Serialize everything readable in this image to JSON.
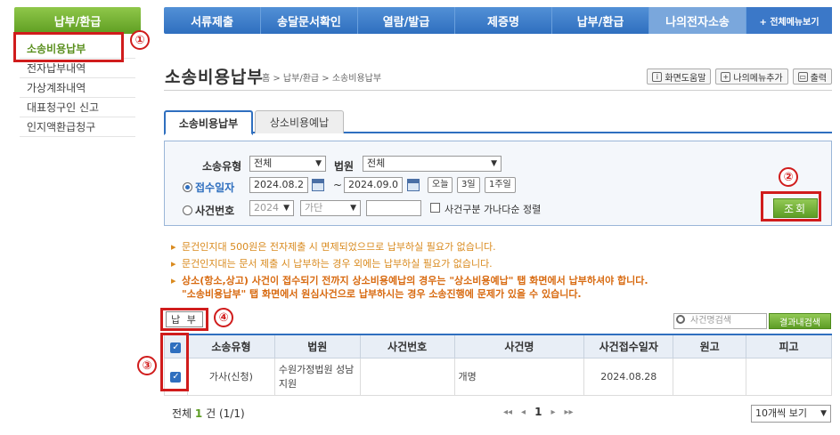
{
  "sidebar": {
    "header": "납부/환급",
    "items": [
      {
        "label": "소송비용납부"
      },
      {
        "label": "전자납부내역"
      },
      {
        "label": "가상계좌내역"
      },
      {
        "label": "대표청구인 신고"
      },
      {
        "label": "인지액환급청구"
      }
    ]
  },
  "annotations": [
    "①",
    "②",
    "③",
    "④"
  ],
  "topnav": {
    "items": [
      "서류제출",
      "송달문서확인",
      "열람/발급",
      "제증명",
      "납부/환급",
      "나의전자소송"
    ],
    "all_menu": "+ 전체메뉴보기"
  },
  "page": {
    "title": "소송비용납부",
    "breadcrumb": "홈 > 납부/환급 > 소송비용납부",
    "tools": {
      "help": "화면도움말",
      "my_menu": "나의메뉴추가",
      "print": "출력"
    }
  },
  "tabs": [
    "소송비용납부",
    "상소비용예납"
  ],
  "search": {
    "case_type_label": "소송유형",
    "case_type_value": "전체",
    "court_label": "법원",
    "court_value": "전체",
    "receipt_date_label": "접수일자",
    "date_from": "2024.08.2",
    "tilde": "~",
    "date_to": "2024.09.0",
    "quick": [
      "오늘",
      "3일",
      "1주일"
    ],
    "case_no_label": "사건번호",
    "year_value": "2024",
    "type_value": "가단",
    "sort_label": "사건구분 가나다순 정렬",
    "query_button": "조회"
  },
  "notices": [
    "문건인지대 500원은 전자제출 시 면제되었으므로 납부하실 필요가 없습니다.",
    "문건인지대는 문서 제출 시 납부하는 경우 외에는 납부하실 필요가 없습니다.",
    "상소(항소,상고) 사건이 접수되기 전까지 상소비용예납의 경우는 \"상소비용예납\" 탭 화면에서 납부하셔야 합니다.",
    "\"소송비용납부\" 탭 화면에서 원심사건으로 납부하시는 경우 소송진행에 문제가 있을 수 있습니다."
  ],
  "pay_button": "납 부",
  "case_search_placeholder": "사건명검색",
  "result_search_button": "결과내검색",
  "table": {
    "headers": [
      "소송유형",
      "법원",
      "사건번호",
      "사건명",
      "사건접수일자",
      "원고",
      "피고"
    ],
    "rows": [
      {
        "type": "가사(신청)",
        "court": "수원가정법원 성남지원",
        "case_no": "",
        "name": "개명",
        "date": "2024.08.28",
        "plaintiff": "",
        "defendant": ""
      }
    ]
  },
  "footer": {
    "total_prefix": "전체",
    "total_count": "1",
    "total_suffix": "건 (1/1)",
    "pager": {
      "first": "◂◂",
      "prev": "◂",
      "current": "1",
      "next": "▸",
      "last": "▸▸"
    },
    "per_page": "10개씩 보기"
  },
  "colors": {
    "nav_blue": "#2f6fbf",
    "green": "#5d9d25",
    "annotation_red": "#d01c1c",
    "notice_orange": "#d98a1e"
  }
}
